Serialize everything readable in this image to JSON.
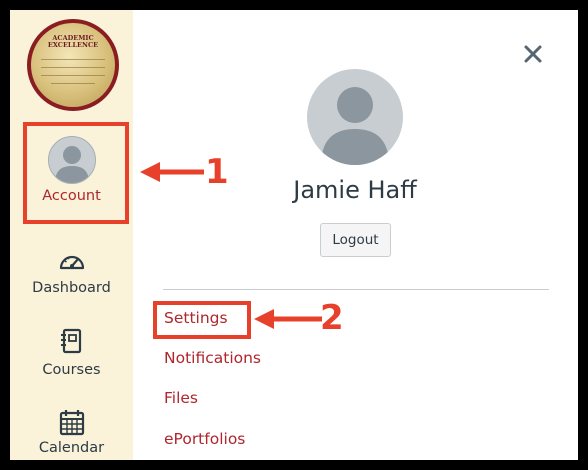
{
  "sidebar": {
    "logo": {
      "text_line1": "ACADEMIC",
      "text_line2": "EXCELLENCE",
      "colors": {
        "ring": "#8a1d22",
        "seal": "#d8c07c"
      }
    },
    "items": [
      {
        "label": "Account",
        "icon": "user-avatar-icon",
        "active": true
      },
      {
        "label": "Dashboard",
        "icon": "dashboard-gauge-icon"
      },
      {
        "label": "Courses",
        "icon": "courses-book-icon"
      },
      {
        "label": "Calendar",
        "icon": "calendar-icon"
      }
    ]
  },
  "tray": {
    "close_icon": "close-icon",
    "user_name": "Jamie Haff",
    "logout_label": "Logout",
    "links": [
      "Settings",
      "Notifications",
      "Files",
      "ePortfolios"
    ]
  },
  "annotations": {
    "callout_1": "1",
    "callout_2": "2"
  },
  "colors": {
    "sidebar_bg": "#faf3da",
    "link_red": "#b0262d",
    "annotation_red": "#e8412b",
    "text_dark": "#2d3b45"
  }
}
